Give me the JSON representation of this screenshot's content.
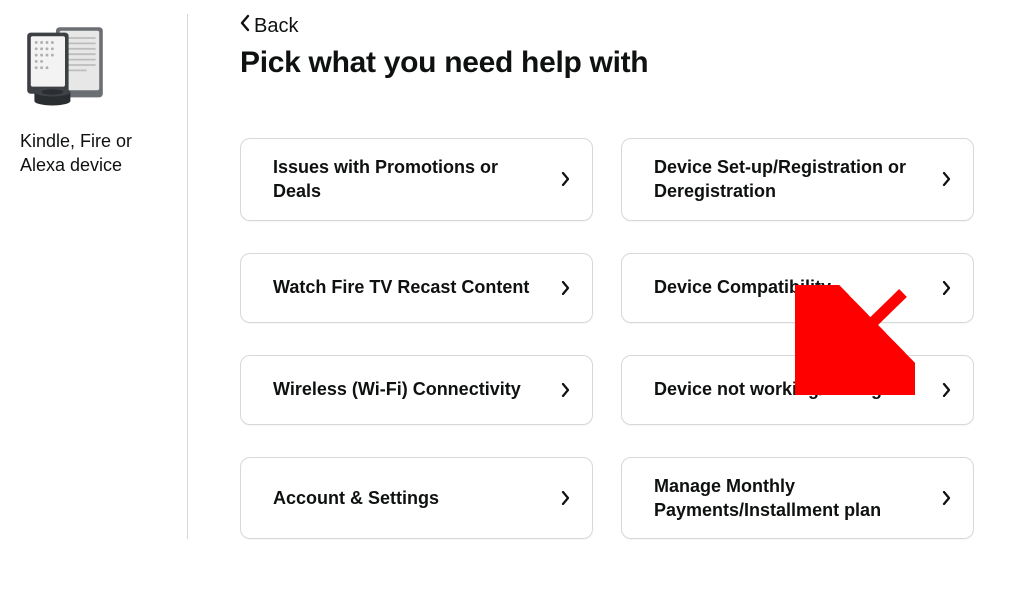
{
  "sidebar": {
    "label": "Kindle, Fire or Alexa device"
  },
  "header": {
    "back_label": "Back",
    "title": "Pick what you need help with"
  },
  "options": {
    "item0": "Issues with Promotions or Deals",
    "item1": "Device Set-up/Registration or Deregistration",
    "item2": "Watch Fire TV Recast Content",
    "item3": "Device Compatibility",
    "item4": "Wireless (Wi-Fi) Connectivity",
    "item5": "Device not working/damaged",
    "item6": "Account & Settings",
    "item7": "Manage Monthly Payments/Installment plan"
  }
}
